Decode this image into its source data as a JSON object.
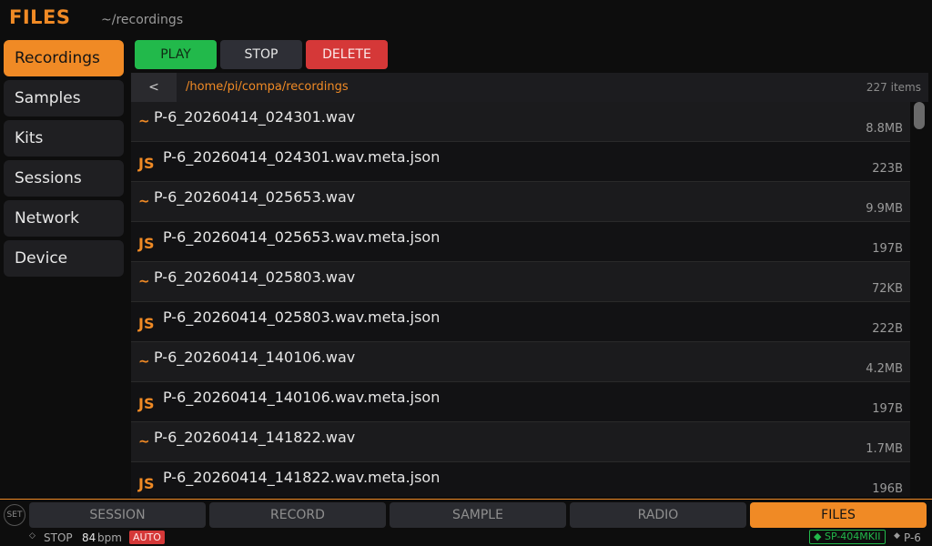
{
  "header": {
    "title": "FILES",
    "path": "~/recordings"
  },
  "sidebar": {
    "items": [
      {
        "label": "Recordings",
        "active": true
      },
      {
        "label": "Samples",
        "active": false
      },
      {
        "label": "Kits",
        "active": false
      },
      {
        "label": "Sessions",
        "active": false
      },
      {
        "label": "Network",
        "active": false
      },
      {
        "label": "Device",
        "active": false
      }
    ]
  },
  "toolbar": {
    "play_label": "PLAY",
    "stop_label": "STOP",
    "delete_label": "DELETE"
  },
  "pathbar": {
    "back_label": "<",
    "path": "/home/pi/compa/recordings",
    "count": "227 items"
  },
  "files": [
    {
      "icon": "~",
      "type": "wav",
      "name": "P-6_20260414_024301.wav",
      "size": "8.8MB"
    },
    {
      "icon": "JS",
      "type": "json",
      "name": "P-6_20260414_024301.wav.meta.json",
      "size": "223B"
    },
    {
      "icon": "~",
      "type": "wav",
      "name": "P-6_20260414_025653.wav",
      "size": "9.9MB"
    },
    {
      "icon": "JS",
      "type": "json",
      "name": "P-6_20260414_025653.wav.meta.json",
      "size": "197B"
    },
    {
      "icon": "~",
      "type": "wav",
      "name": "P-6_20260414_025803.wav",
      "size": "72KB"
    },
    {
      "icon": "JS",
      "type": "json",
      "name": "P-6_20260414_025803.wav.meta.json",
      "size": "222B"
    },
    {
      "icon": "~",
      "type": "wav",
      "name": "P-6_20260414_140106.wav",
      "size": "4.2MB"
    },
    {
      "icon": "JS",
      "type": "json",
      "name": "P-6_20260414_140106.wav.meta.json",
      "size": "197B"
    },
    {
      "icon": "~",
      "type": "wav",
      "name": "P-6_20260414_141822.wav",
      "size": "1.7MB"
    },
    {
      "icon": "JS",
      "type": "json",
      "name": "P-6_20260414_141822.wav.meta.json",
      "size": "196B"
    }
  ],
  "tabs": [
    {
      "label": "SESSION",
      "active": false
    },
    {
      "label": "RECORD",
      "active": false
    },
    {
      "label": "SAMPLE",
      "active": false
    },
    {
      "label": "RADIO",
      "active": false
    },
    {
      "label": "FILES",
      "active": true
    }
  ],
  "set_label": "SET",
  "status": {
    "state": "STOP",
    "bpm": "84",
    "bpm_unit": "bpm",
    "mode": "AUTO",
    "device": "SP-404MKII",
    "model": "P-6"
  },
  "colors": {
    "accent": "#f08a25",
    "play": "#22b94b",
    "delete": "#d53838"
  }
}
